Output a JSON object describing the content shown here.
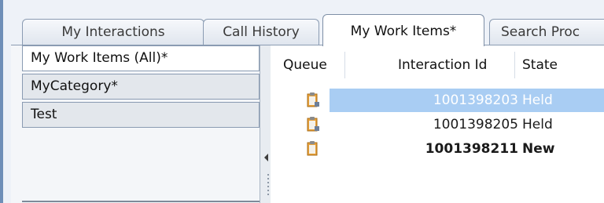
{
  "tabs": [
    {
      "label": "My Interactions",
      "active": false
    },
    {
      "label": "Call History",
      "active": false
    },
    {
      "label": "My Work Items*",
      "active": true
    },
    {
      "label": "Search Proc",
      "active": false
    }
  ],
  "categories": [
    {
      "label": "My Work Items (All)*",
      "selected": true
    },
    {
      "label": "MyCategory*",
      "selected": false
    },
    {
      "label": "Test",
      "selected": false
    }
  ],
  "table": {
    "columns": [
      "Queue",
      "Interaction Id",
      "State"
    ],
    "rows": [
      {
        "queue_icon": "clipboard-queue-icon",
        "interaction_id": "1001398203",
        "state": "Held",
        "selected": true,
        "bold": false
      },
      {
        "queue_icon": "clipboard-queue-icon",
        "interaction_id": "1001398205",
        "state": "Held",
        "selected": false,
        "bold": false
      },
      {
        "queue_icon": "clipboard-queue-icon",
        "interaction_id": "1001398211",
        "state": "New",
        "selected": false,
        "bold": true
      }
    ]
  },
  "colors": {
    "selection": "#a9cdf3",
    "tab_border": "#8a9bb2",
    "icon_orange": "#e8a23c"
  }
}
